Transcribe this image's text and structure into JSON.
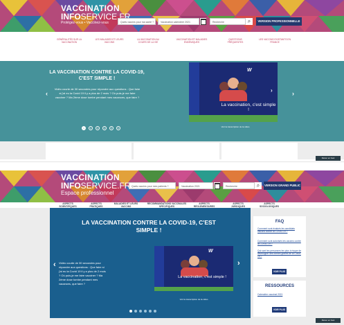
{
  "colors": {
    "teal": "#46929a",
    "navy": "#22386d",
    "blue_hero": "#1a5f8e",
    "nav_pink": "#c23a5b"
  },
  "public": {
    "logo": {
      "line1": "VACCINATION",
      "line2_bold": "INFO",
      "line2_light": "SERVICE.FR",
      "tagline": "Protégez-vous • Vaccinez-vous"
    },
    "search": {
      "question_placeholder": "Quels vaccins pour ma santé ?",
      "date_placeholder": "Vaccination calendrier 2021",
      "term_placeholder": "Recherche"
    },
    "pro_button": "VERSION PROFESSIONNELLE",
    "nav": [
      "GÉNÉRALITÉS SUR LA VACCINATION",
      "LES MALADIES ET LEURS VACCINS",
      "LA VACCINATION AU COURS DE LA VIE",
      "VACCINATION ET MALADIES ENDÉMIQUES",
      "QUESTIONS FRÉQUENTES",
      "LES VACCINS EXISTANTS EN FRANCE"
    ],
    "hero": {
      "title": "LA VACCINATION CONTRE LA COVID-19, C'EST SIMPLE !",
      "description": "Vidéo courte de 30 secondes pour répondre aux questions : Que faire si j'ai eu la Covid 19 il y a plus de 2 mois ? Où puis-je me faire vacciner ? Ma 2ème dose tombe pendant mes vacances, que faire ?",
      "video_caption": "La vaccination, c'est simple !",
      "video_link": "Voir la transcription de la vidéo",
      "dots": [
        "1",
        "2",
        "3",
        "4",
        "5",
        "6"
      ],
      "active_dot": 0
    },
    "back_to_top": "Retour en haut"
  },
  "pro": {
    "logo": {
      "line1": "VACCINATION",
      "line2_bold": "INFO",
      "line2_light": "SERVICE.FR",
      "tagline": "Espace professionnel"
    },
    "search": {
      "question_placeholder": "Quels vaccins pour mes patients ?",
      "date_placeholder": "Vaccination 2021",
      "term_placeholder": "Recherche"
    },
    "public_button": "VERSION GRAND PUBLIC",
    "nav": [
      "ASPECTS SCIENTIFIQUES",
      "ASPECTS PRATIQUES",
      "MALADIES ET LEURS VACCINS",
      "RECOMMANDATIONS VACCINALES SPÉCIFIQUES",
      "ASPECTS RÉGLEMENTAIRES",
      "ASPECTS JURIDIQUES",
      "ASPECTS SOCIOLOGIQUES"
    ],
    "hero": {
      "title": "LA VACCINATION CONTRE LA COVID-19, C'EST SIMPLE !",
      "description": "Vidéo courte de 30 secondes pour répondre aux questions : Que faire si j'ai eu la Covid 19 il y a plus de 2 mois ? Où puis-je me faire vacciner ? Ma 2ème dose tombe pendant mes vacances, que faire ?",
      "video_caption": "La vaccination, c'est simple !",
      "video_link": "Voir la transcription de la vidéo",
      "dots_count": 6,
      "active_dot": 0
    },
    "faq": {
      "title": "FAQ",
      "items": [
        "Comment sont évalués les candidats vaccins contre la COVID-19 ?",
        "Comment sont autorisés les vaccins contre la COVID-19 ?",
        "Qui sont les personnes les plus à risque de développer des formes graves de la Covid-19 ?"
      ],
      "button": "VOIR PLUS"
    },
    "resources": {
      "title": "RESSOURCES",
      "items": [
        "Calendrier vaccinal 2021"
      ],
      "button": "VOIR PLUS"
    },
    "back_to_top": "Retour en haut"
  }
}
